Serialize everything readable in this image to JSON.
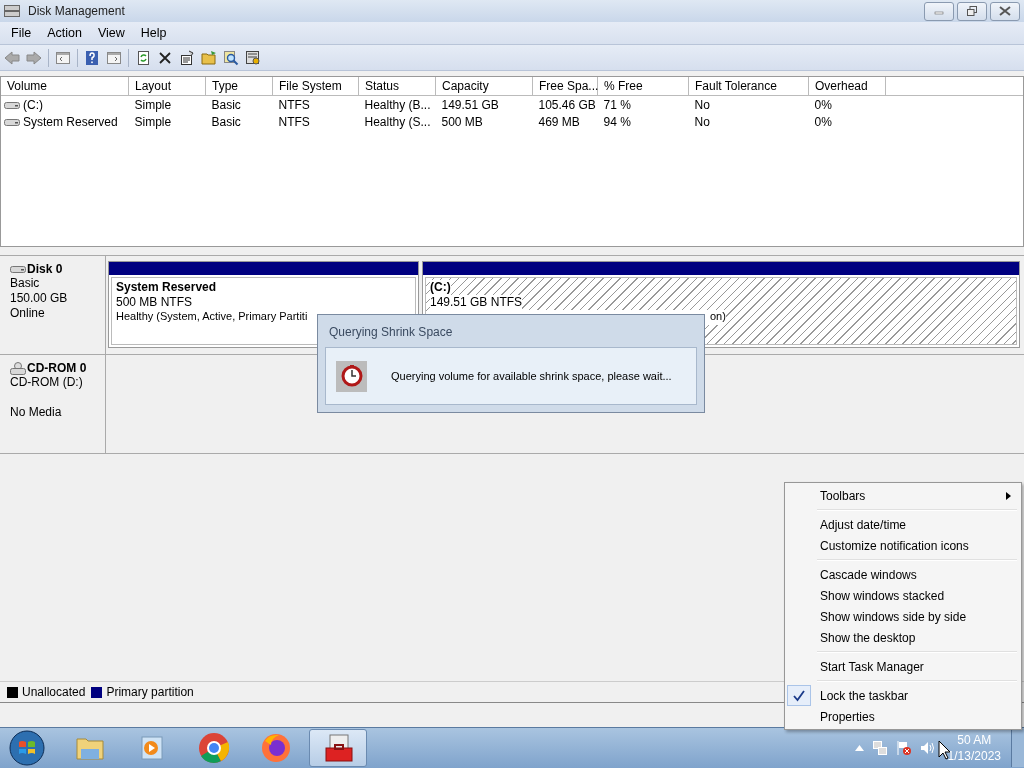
{
  "window": {
    "title": "Disk Management"
  },
  "menu": [
    "File",
    "Action",
    "View",
    "Help"
  ],
  "table": {
    "columns": [
      "Volume",
      "Layout",
      "Type",
      "File System",
      "Status",
      "Capacity",
      "Free Spa...",
      "% Free",
      "Fault Tolerance",
      "Overhead"
    ],
    "rows": [
      [
        "(C:)",
        "Simple",
        "Basic",
        "NTFS",
        "Healthy (B...",
        "149.51 GB",
        "105.46 GB",
        "71 %",
        "No",
        "0%"
      ],
      [
        "System Reserved",
        "Simple",
        "Basic",
        "NTFS",
        "Healthy (S...",
        "500 MB",
        "469 MB",
        "94 %",
        "No",
        "0%"
      ]
    ]
  },
  "disks": [
    {
      "kind": "disk",
      "name": "Disk 0",
      "lines": [
        "Basic",
        "150.00 GB",
        "Online"
      ],
      "partitions": [
        {
          "title": "System Reserved",
          "size": "500 MB NTFS",
          "status": "Healthy (System, Active, Primary Partiti",
          "hatched": false
        },
        {
          "title": "(C:)",
          "size": "149.51 GB NTFS",
          "status": "on)",
          "hatched": true
        }
      ]
    },
    {
      "kind": "cdrom",
      "name": "CD-ROM 0",
      "lines": [
        "CD-ROM (D:)",
        "No Media"
      ]
    }
  ],
  "legend": [
    {
      "label": "Unallocated",
      "color": "#000000"
    },
    {
      "label": "Primary partition",
      "color": "#000080"
    }
  ],
  "dialog": {
    "title": "Querying Shrink Space",
    "message": "Querying volume for available shrink space, please wait..."
  },
  "context_menu": {
    "groups": [
      [
        {
          "label": "Toolbars",
          "checked": false,
          "submenu": true
        }
      ],
      [
        {
          "label": "Adjust date/time",
          "checked": false,
          "submenu": false
        },
        {
          "label": "Customize notification icons",
          "checked": false,
          "submenu": false
        }
      ],
      [
        {
          "label": "Cascade windows",
          "checked": false,
          "submenu": false
        },
        {
          "label": "Show windows stacked",
          "checked": false,
          "submenu": false
        },
        {
          "label": "Show windows side by side",
          "checked": false,
          "submenu": false
        },
        {
          "label": "Show the desktop",
          "checked": false,
          "submenu": false
        }
      ],
      [
        {
          "label": "Start Task Manager",
          "checked": false,
          "submenu": false
        }
      ],
      [
        {
          "label": "Lock the taskbar",
          "checked": true,
          "submenu": false
        },
        {
          "label": "Properties",
          "checked": false,
          "submenu": false
        }
      ]
    ]
  },
  "taskbar": {
    "apps": [
      {
        "kind": "explorer",
        "selected": false
      },
      {
        "kind": "media",
        "selected": false
      },
      {
        "kind": "chrome",
        "selected": false
      },
      {
        "kind": "firefox",
        "selected": false
      },
      {
        "kind": "diskmgmt",
        "selected": true
      }
    ],
    "clock": {
      "time": "50 AM",
      "date": "1/13/2023"
    }
  }
}
